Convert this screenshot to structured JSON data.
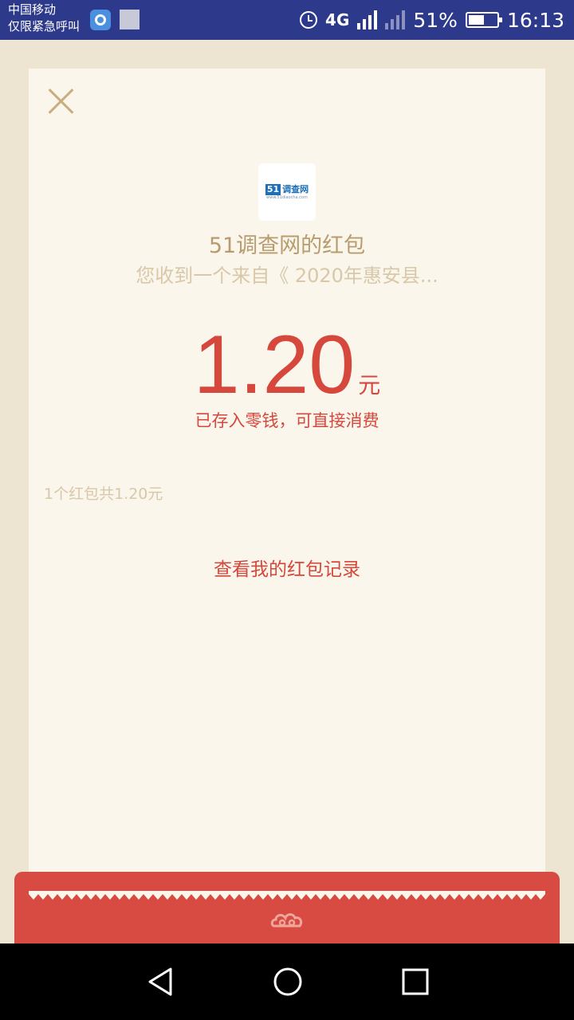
{
  "status_bar": {
    "carrier_line1": "中国移动",
    "carrier_line2": "仅限紧急呼叫",
    "network_1": "4G",
    "network_2": "4G",
    "battery": "51%",
    "time": "16:13",
    "icons": [
      "app-icon",
      "gallery-icon",
      "alarm-icon",
      "signal-icon",
      "no-signal-icon",
      "battery-icon"
    ]
  },
  "red_packet": {
    "logo": {
      "number": "51",
      "name": "调查网",
      "url": "www.51diaocha.com"
    },
    "sender_title": "51调查网的红包",
    "description": "您收到一个来自《 2020年惠安县...",
    "amount": "1.20",
    "unit": "元",
    "deposit_note": "已存入零钱，可直接消费",
    "summary": "1个红包共1.20元",
    "records_link": "查看我的红包记录"
  },
  "colors": {
    "accent_red": "#d6473c",
    "gold": "#b89c6e",
    "light_gold": "#d9c8a8",
    "card_bg": "#faf6ec",
    "page_bg": "#ede4d1"
  },
  "nav_bar": {
    "icons": [
      "back-icon",
      "home-icon",
      "recents-icon"
    ]
  }
}
